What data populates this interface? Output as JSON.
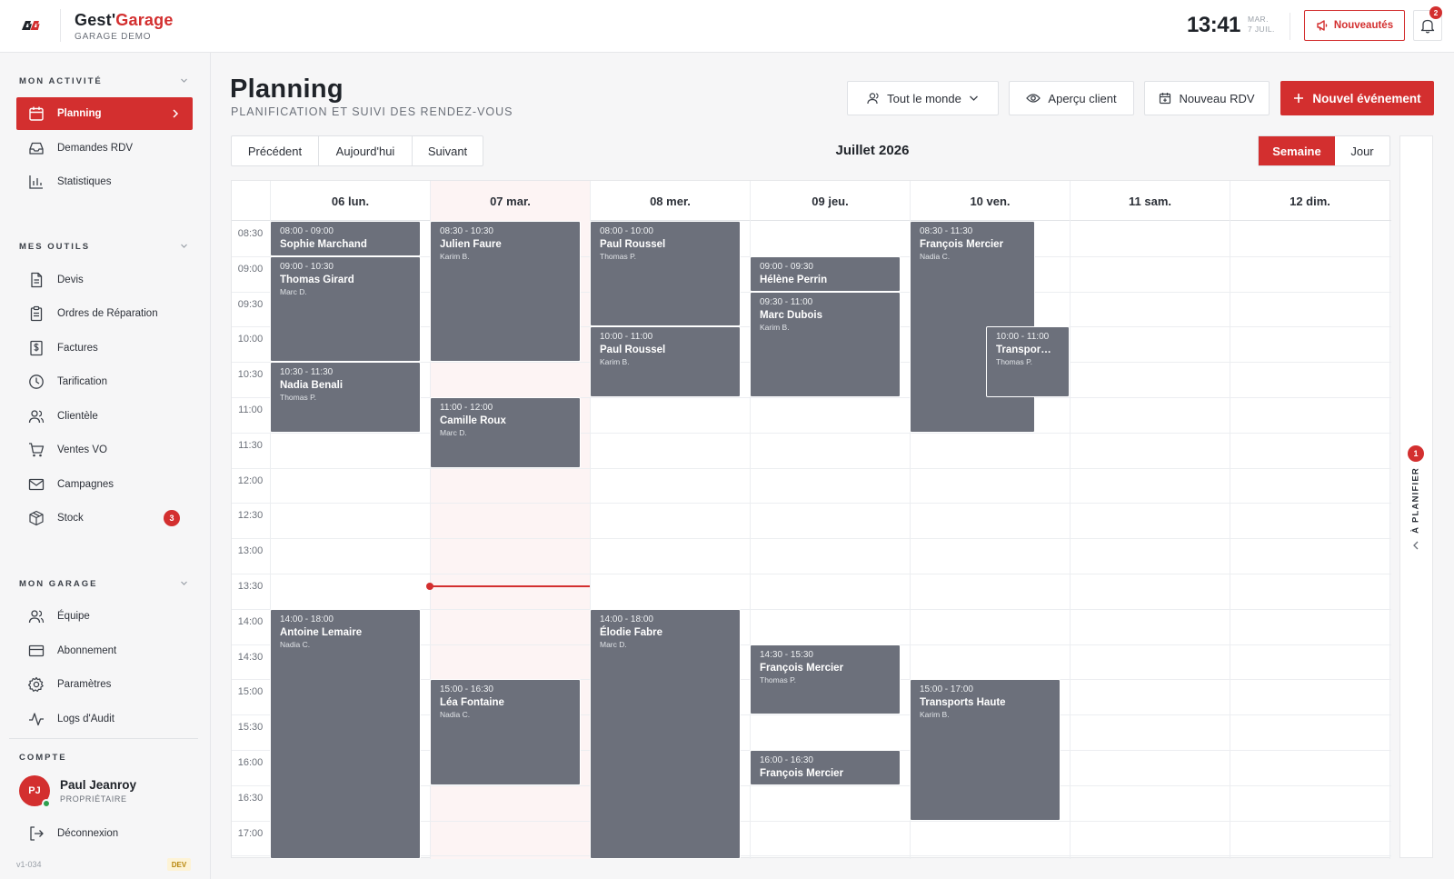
{
  "brand": {
    "name_main": "Gest'",
    "name_accent": "Garage",
    "subtitle": "GARAGE DEMO"
  },
  "header": {
    "time": "13:41",
    "date_line1": "MAR.",
    "date_line2": "7 JUIL.",
    "news_label": "Nouveautés",
    "notification_count": "2"
  },
  "sidebar": {
    "sections": [
      {
        "title": "MON ACTIVITÉ",
        "items": [
          {
            "label": "Planning",
            "icon": "calendar-icon",
            "active": true
          },
          {
            "label": "Demandes RDV",
            "icon": "inbox-icon"
          },
          {
            "label": "Statistiques",
            "icon": "bar-chart-icon"
          }
        ]
      },
      {
        "title": "MES OUTILS",
        "items": [
          {
            "label": "Devis",
            "icon": "document-icon"
          },
          {
            "label": "Ordres de Réparation",
            "icon": "clipboard-icon"
          },
          {
            "label": "Factures",
            "icon": "invoice-icon"
          },
          {
            "label": "Tarification",
            "icon": "clock-icon"
          },
          {
            "label": "Clientèle",
            "icon": "users-icon"
          },
          {
            "label": "Ventes VO",
            "icon": "cart-icon"
          },
          {
            "label": "Campagnes",
            "icon": "mail-icon"
          },
          {
            "label": "Stock",
            "icon": "box-icon",
            "badge": "3"
          }
        ]
      },
      {
        "title": "MON GARAGE",
        "items": [
          {
            "label": "Équipe",
            "icon": "team-icon"
          },
          {
            "label": "Abonnement",
            "icon": "credit-card-icon"
          },
          {
            "label": "Paramètres",
            "icon": "gear-icon"
          },
          {
            "label": "Logs d'Audit",
            "icon": "activity-icon"
          }
        ]
      }
    ],
    "account": {
      "title": "COMPTE",
      "initials": "PJ",
      "name": "Paul Jeanroy",
      "role": "PROPRIÉTAIRE",
      "logout": "Déconnexion",
      "version": "v1-034",
      "env_badge": "DEV"
    }
  },
  "page": {
    "title": "Planning",
    "subtitle": "PLANIFICATION ET SUIVI DES RENDEZ-VOUS",
    "filter_label": "Tout le monde",
    "preview_label": "Aperçu client",
    "new_rdv_label": "Nouveau RDV",
    "new_event_label": "Nouvel événement"
  },
  "calendar": {
    "nav": {
      "prev": "Précédent",
      "today": "Aujourd'hui",
      "next": "Suivant"
    },
    "month_label": "Juillet 2026",
    "views": {
      "week": "Semaine",
      "day": "Jour"
    },
    "days": [
      "06 lun.",
      "07 mar.",
      "08 mer.",
      "09 jeu.",
      "10 ven.",
      "11 sam.",
      "12 dim."
    ],
    "today_index": 1,
    "times": [
      "08:30",
      "09:00",
      "09:30",
      "10:00",
      "10:30",
      "11:00",
      "11:30",
      "12:00",
      "12:30",
      "13:00",
      "13:30",
      "14:00",
      "14:30",
      "15:00",
      "15:30",
      "16:00",
      "16:30",
      "17:00"
    ],
    "current_time": "13:41",
    "events": [
      {
        "day": 0,
        "time": "08:00 - 09:00",
        "name": "Sophie Marchand",
        "mech": ""
      },
      {
        "day": 0,
        "time": "09:00 - 10:30",
        "name": "Thomas Girard",
        "mech": "Marc D."
      },
      {
        "day": 0,
        "time": "10:30 - 11:30",
        "name": "Nadia Benali",
        "mech": "Thomas P."
      },
      {
        "day": 0,
        "time": "14:00 - 18:00",
        "name": "Antoine Lemaire",
        "mech": "Nadia C."
      },
      {
        "day": 1,
        "time": "08:30 - 10:30",
        "name": "Julien Faure",
        "mech": "Karim B."
      },
      {
        "day": 1,
        "time": "11:00 - 12:00",
        "name": "Camille Roux",
        "mech": "Marc D."
      },
      {
        "day": 1,
        "time": "15:00 - 16:30",
        "name": "Léa Fontaine",
        "mech": "Nadia C."
      },
      {
        "day": 2,
        "time": "08:00 - 10:00",
        "name": "Paul Roussel",
        "mech": "Thomas P."
      },
      {
        "day": 2,
        "time": "10:00 - 11:00",
        "name": "Paul Roussel",
        "mech": "Karim B."
      },
      {
        "day": 2,
        "time": "14:00 - 18:00",
        "name": "Élodie Fabre",
        "mech": "Marc D."
      },
      {
        "day": 3,
        "time": "09:00 - 09:30",
        "name": "Hélène Perrin",
        "mech": ""
      },
      {
        "day": 3,
        "time": "09:30 - 11:00",
        "name": "Marc Dubois",
        "mech": "Karim B."
      },
      {
        "day": 3,
        "time": "14:30 - 15:30",
        "name": "François Mercier",
        "mech": "Thomas P."
      },
      {
        "day": 3,
        "time": "16:00 - 16:30",
        "name": "François Mercier",
        "mech": ""
      },
      {
        "day": 4,
        "time": "08:30 - 11:30",
        "name": "François Mercier",
        "mech": "Nadia C."
      },
      {
        "day": 4,
        "time": "10:00 - 11:00",
        "name": "Transpor…",
        "mech": "Thomas P."
      },
      {
        "day": 4,
        "time": "15:00 - 17:00",
        "name": "Transports Haute",
        "mech": "Karim B."
      }
    ]
  },
  "right_panel": {
    "label": "À PLANIFIER",
    "count": "1"
  }
}
